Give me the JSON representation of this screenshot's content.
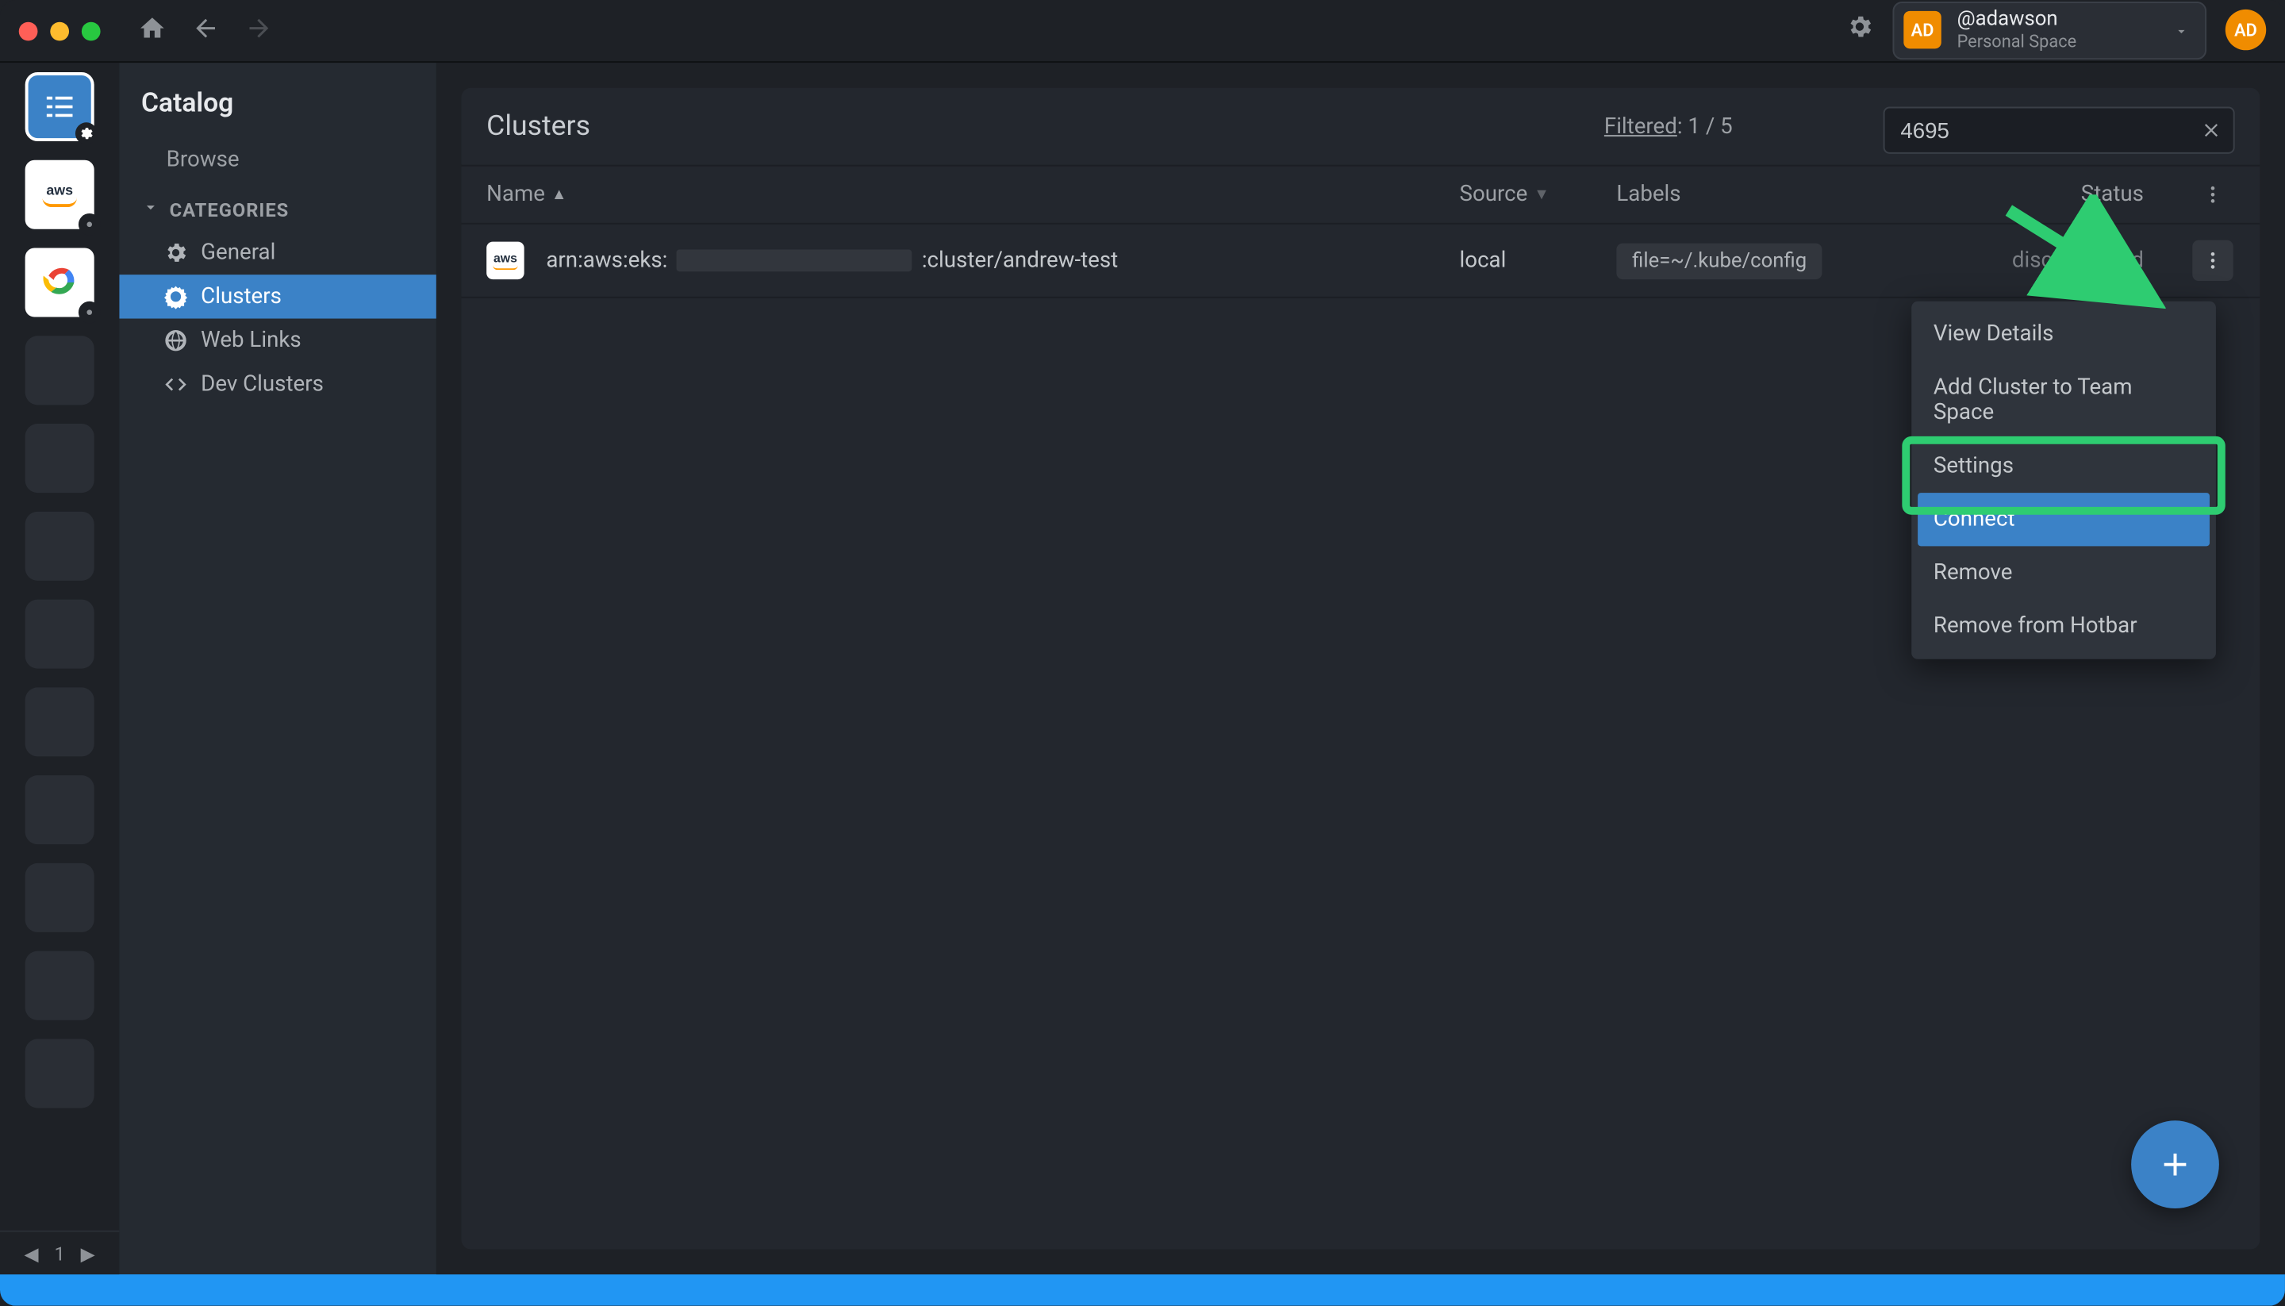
{
  "titlebar": {
    "user_name": "@adawson",
    "user_space": "Personal Space",
    "avatar_initials": "AD"
  },
  "sidebar": {
    "title": "Catalog",
    "browse": "Browse",
    "section": "CATEGORIES",
    "items": [
      {
        "label": "General"
      },
      {
        "label": "Clusters"
      },
      {
        "label": "Web Links"
      },
      {
        "label": "Dev Clusters"
      }
    ]
  },
  "hotbar": {
    "page": "1"
  },
  "main": {
    "title": "Clusters",
    "filter_label": "Filtered",
    "filter_count": ": 1 / 5",
    "search_value": "4695",
    "columns": {
      "name": "Name",
      "source": "Source",
      "labels": "Labels",
      "status": "Status"
    },
    "row": {
      "name_prefix": "arn:aws:eks:",
      "name_suffix": ":cluster/andrew-test",
      "source": "local",
      "label": "file=~/.kube/config",
      "status": "disconnected"
    }
  },
  "context_menu": {
    "items": [
      "View Details",
      "Add Cluster to Team Space",
      "Settings",
      "Connect",
      "Remove",
      "Remove from Hotbar"
    ]
  }
}
